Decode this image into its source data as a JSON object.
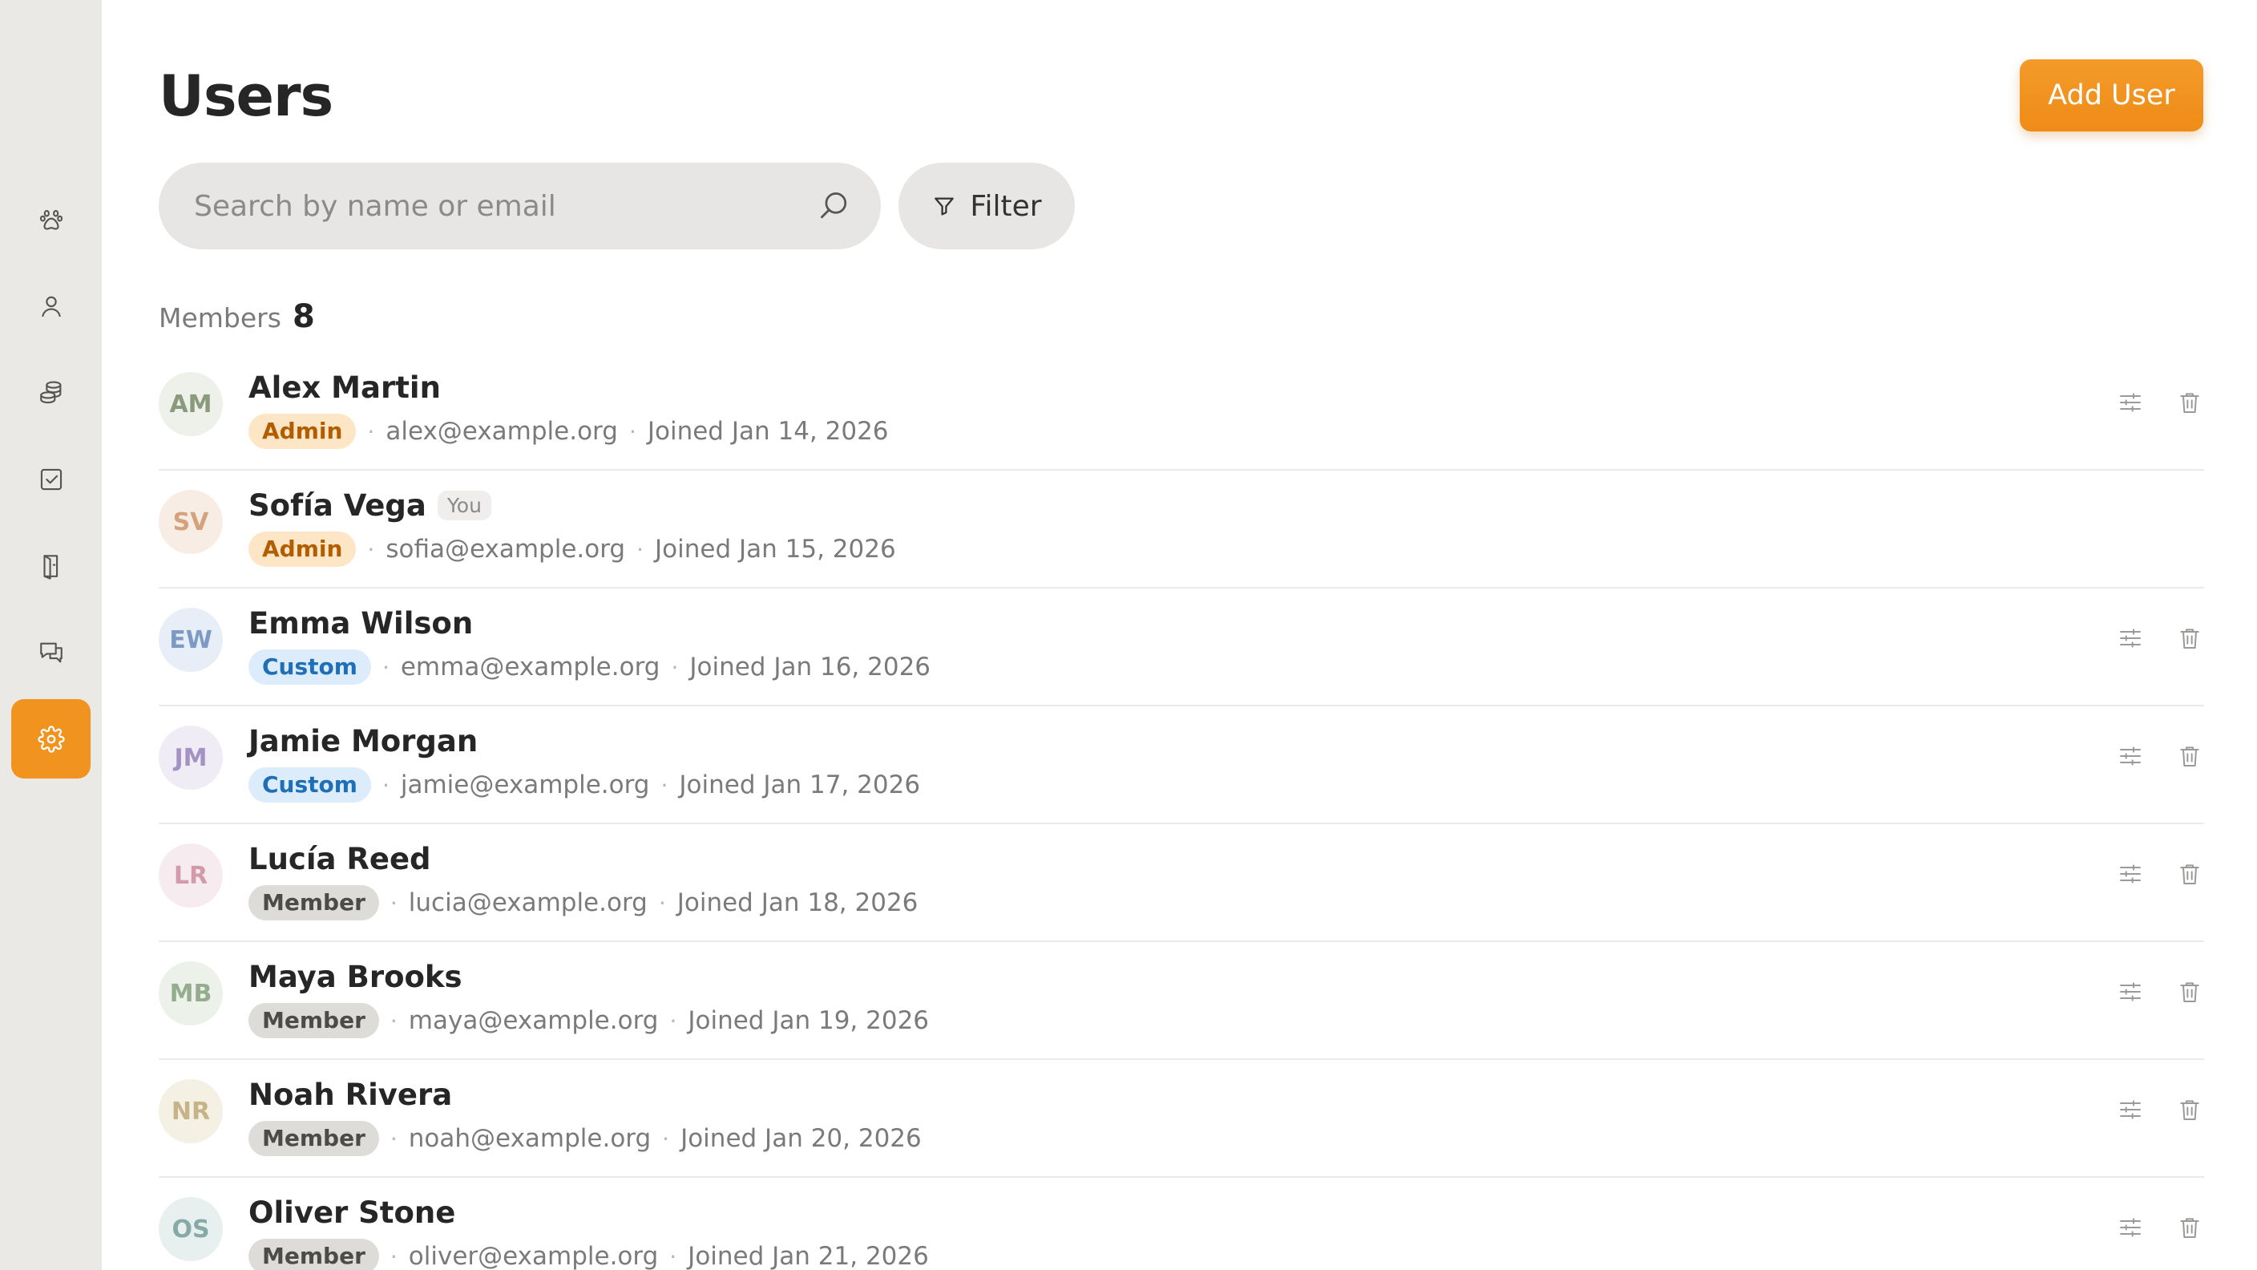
{
  "page": {
    "title": "Users",
    "add_user_label": "Add User",
    "search_placeholder": "Search by name or email",
    "filter_label": "Filter",
    "members_label": "Members",
    "members_count": "8"
  },
  "sidebar": {
    "items": [
      {
        "icon": "paw-icon",
        "active": false
      },
      {
        "icon": "user-icon",
        "active": false
      },
      {
        "icon": "coins-icon",
        "active": false
      },
      {
        "icon": "checkbox-icon",
        "active": false
      },
      {
        "icon": "book-icon",
        "active": false
      },
      {
        "icon": "chat-icon",
        "active": false
      },
      {
        "icon": "gear-icon",
        "active": true
      }
    ]
  },
  "colors": {
    "accent": "#f0931f",
    "admin_bg": "#fde6c6",
    "custom_bg": "#dcecfb",
    "member_bg": "#dedcd8"
  },
  "users": [
    {
      "initials": "AM",
      "name": "Alex Martin",
      "you": "",
      "role": "Admin",
      "email": "alex@example.org",
      "joined": "Joined Jan 14, 2026",
      "avatar_bg": "#eef1ea",
      "avatar_fg": "#8a9a7c",
      "actions": true
    },
    {
      "initials": "SV",
      "name": "Sofía Vega",
      "you": "You",
      "role": "Admin",
      "email": "sofia@example.org",
      "joined": "Joined Jan 15, 2026",
      "avatar_bg": "#f8ede4",
      "avatar_fg": "#d4a27c",
      "actions": false
    },
    {
      "initials": "EW",
      "name": "Emma Wilson",
      "you": "",
      "role": "Custom",
      "email": "emma@example.org",
      "joined": "Joined Jan 16, 2026",
      "avatar_bg": "#e8eef7",
      "avatar_fg": "#7d9bc2",
      "actions": true
    },
    {
      "initials": "JM",
      "name": "Jamie Morgan",
      "you": "",
      "role": "Custom",
      "email": "jamie@example.org",
      "joined": "Joined Jan 17, 2026",
      "avatar_bg": "#efecf5",
      "avatar_fg": "#a592c4",
      "actions": true
    },
    {
      "initials": "LR",
      "name": "Lucía Reed",
      "you": "",
      "role": "Member",
      "email": "lucia@example.org",
      "joined": "Joined Jan 18, 2026",
      "avatar_bg": "#f6ecef",
      "avatar_fg": "#d29aab",
      "actions": true
    },
    {
      "initials": "MB",
      "name": "Maya Brooks",
      "you": "",
      "role": "Member",
      "email": "maya@example.org",
      "joined": "Joined Jan 19, 2026",
      "avatar_bg": "#ecf1ea",
      "avatar_fg": "#93ad8e",
      "actions": true
    },
    {
      "initials": "NR",
      "name": "Noah Rivera",
      "you": "",
      "role": "Member",
      "email": "noah@example.org",
      "joined": "Joined Jan 20, 2026",
      "avatar_bg": "#f5f0e4",
      "avatar_fg": "#c6b388",
      "actions": true
    },
    {
      "initials": "OS",
      "name": "Oliver Stone",
      "you": "",
      "role": "Member",
      "email": "oliver@example.org",
      "joined": "Joined Jan 21, 2026",
      "avatar_bg": "#e8f0ef",
      "avatar_fg": "#86aaa7",
      "actions": true
    }
  ]
}
